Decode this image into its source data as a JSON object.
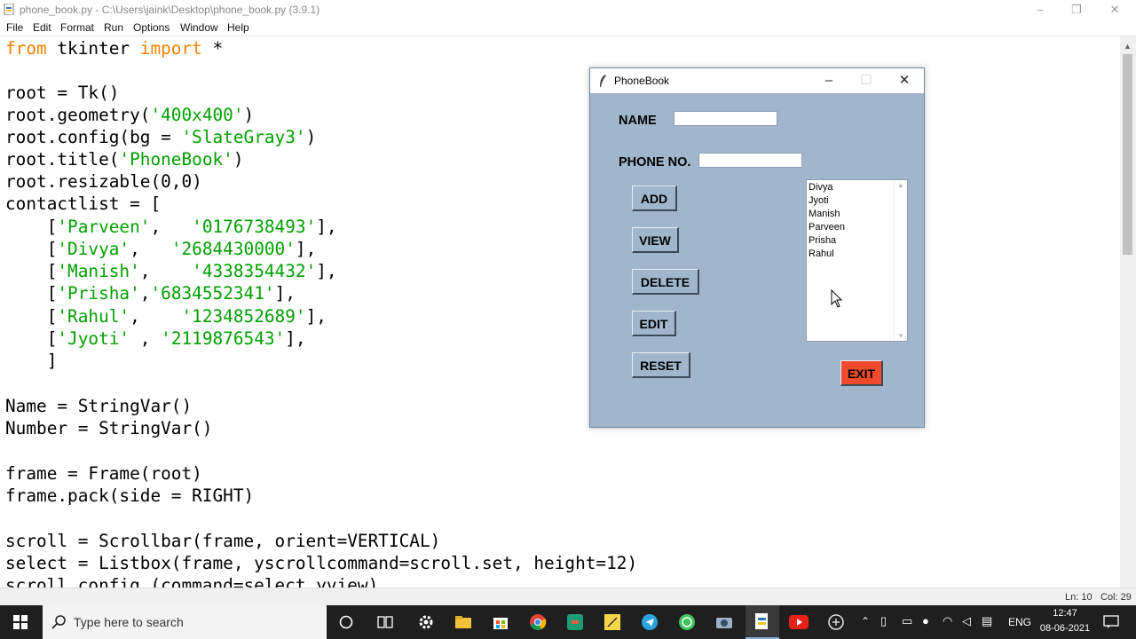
{
  "window": {
    "title": "phone_book.py - C:\\Users\\jaink\\Desktop\\phone_book.py (3.9.1)",
    "minimize": "–",
    "maximize": "❐",
    "close": "✕"
  },
  "menu": [
    "File",
    "Edit",
    "Format",
    "Run",
    "Options",
    "Window",
    "Help"
  ],
  "code": {
    "l1": {
      "kw1": "from",
      "mid": " tkinter ",
      "kw2": "import",
      "tail": " *"
    },
    "l3": "root = Tk()",
    "l4": {
      "a": "root.geometry(",
      "s": "'400x400'",
      "b": ")"
    },
    "l5": {
      "a": "root.config(bg = ",
      "s": "'SlateGray3'",
      "b": ")"
    },
    "l6": {
      "a": "root.title(",
      "s": "'PhoneBook'",
      "b": ")"
    },
    "l7": "root.resizable(0,0)",
    "l8": "contactlist = [",
    "rows": [
      {
        "pre": "    [",
        "name": "'Parveen'",
        "sep": ",   ",
        "num": "'0176738493'",
        "post": "],"
      },
      {
        "pre": "    [",
        "name": "'Divya'",
        "sep": ",   ",
        "num": "'2684430000'",
        "post": "],"
      },
      {
        "pre": "    [",
        "name": "'Manish'",
        "sep": ",    ",
        "num": "'4338354432'",
        "post": "],"
      },
      {
        "pre": "    [",
        "name": "'Prisha'",
        "sep": ",",
        "num": "'6834552341'",
        "post": "],"
      },
      {
        "pre": "    [",
        "name": "'Rahul'",
        "sep": ",    ",
        "num": "'1234852689'",
        "post": "],"
      },
      {
        "pre": "    [",
        "name": "'Jyoti'",
        "sep": " , ",
        "num": "'2119876543'",
        "post": "],"
      }
    ],
    "l15": "    ]",
    "l17": "Name = StringVar()",
    "l18": "Number = StringVar()",
    "l20": "frame = Frame(root)",
    "l21": "frame.pack(side = RIGHT)",
    "l23": "scroll = Scrollbar(frame, orient=VERTICAL)",
    "l24": "select = Listbox(frame, yscrollcommand=scroll.set, height=12)",
    "l25": "scroll.config (command=select.yview)"
  },
  "status": {
    "line": "Ln: 10",
    "col": "Col: 29"
  },
  "phonebook": {
    "title": "PhoneBook",
    "name_label": "NAME",
    "phone_label": "PHONE NO.",
    "name_value": "",
    "phone_value": "",
    "buttons": {
      "add": "ADD",
      "view": "VIEW",
      "delete": "DELETE",
      "edit": "EDIT",
      "reset": "RESET",
      "exit": "EXIT"
    },
    "contacts": [
      "Divya",
      "Jyoti",
      "Manish",
      "Parveen",
      "Prisha",
      "Rahul"
    ]
  },
  "taskbar": {
    "search_placeholder": "Type here to search",
    "language": "ENG",
    "time": "12:47",
    "date": "08-06-2021"
  },
  "colors": {
    "keyword": "#f08000",
    "string": "#00a000",
    "tk_bg": "#9fb6cd",
    "exit_button": "#f04a2c",
    "taskbar": "#1f1f1f"
  }
}
